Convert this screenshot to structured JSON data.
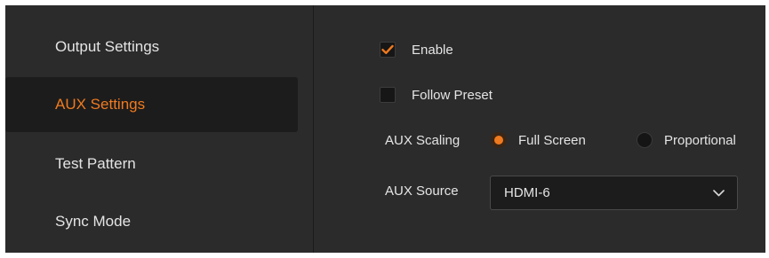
{
  "sidebar": {
    "items": [
      {
        "label": "Output Settings",
        "active": false
      },
      {
        "label": "AUX Settings",
        "active": true
      },
      {
        "label": "Test Pattern",
        "active": false
      },
      {
        "label": "Sync Mode",
        "active": false
      }
    ]
  },
  "settings": {
    "enable": {
      "label": "Enable",
      "checked": true
    },
    "follow_preset": {
      "label": "Follow Preset",
      "checked": false
    },
    "aux_scaling": {
      "label": "AUX Scaling",
      "options": [
        {
          "label": "Full Screen",
          "selected": true
        },
        {
          "label": "Proportional",
          "selected": false
        }
      ]
    },
    "aux_source": {
      "label": "AUX Source",
      "value": "HDMI-6",
      "icon": "chevron-down-icon"
    }
  },
  "colors": {
    "accent": "#f07a1f",
    "panel_bg": "#2b2b2b",
    "active_item_bg": "#1c1c1c",
    "text": "#e4e4e4"
  }
}
